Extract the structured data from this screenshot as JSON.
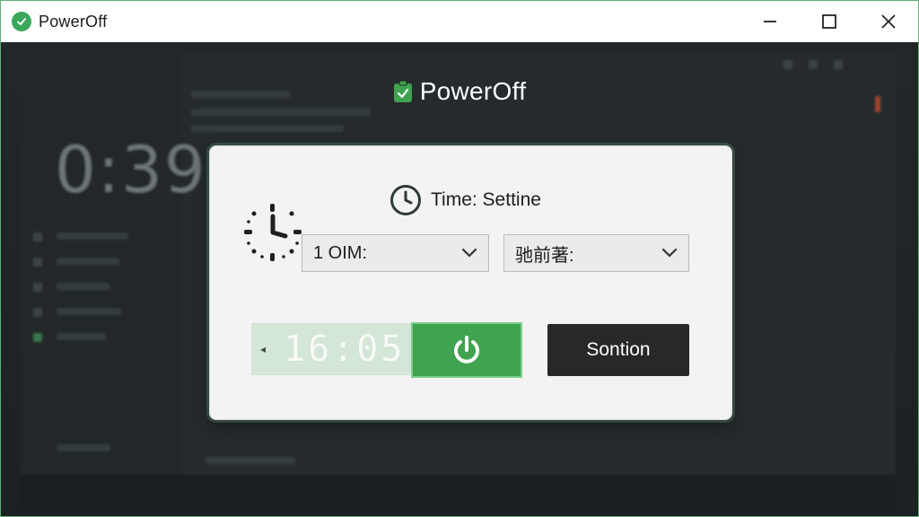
{
  "window": {
    "title": "PowerOff",
    "controls": {
      "minimize": "minimize",
      "maximize": "maximize",
      "close": "close"
    }
  },
  "background": {
    "clock_text": "0:39"
  },
  "app_header": {
    "title": "PowerOff",
    "icon": "clipboard-check-icon"
  },
  "dialog": {
    "title": "Time: Settine",
    "title_icon": "clock-icon",
    "big_icon": "stopwatch-icon",
    "select_left": {
      "value": "1 OIM:"
    },
    "select_right": {
      "value": "驰前著:"
    },
    "digital_time": "16:05",
    "power_button_icon": "power-icon",
    "action_button_label": "Sontion"
  },
  "colors": {
    "accent_green": "#3fa34f",
    "dark_button": "#262829",
    "card_bg": "#f2f3f2"
  }
}
